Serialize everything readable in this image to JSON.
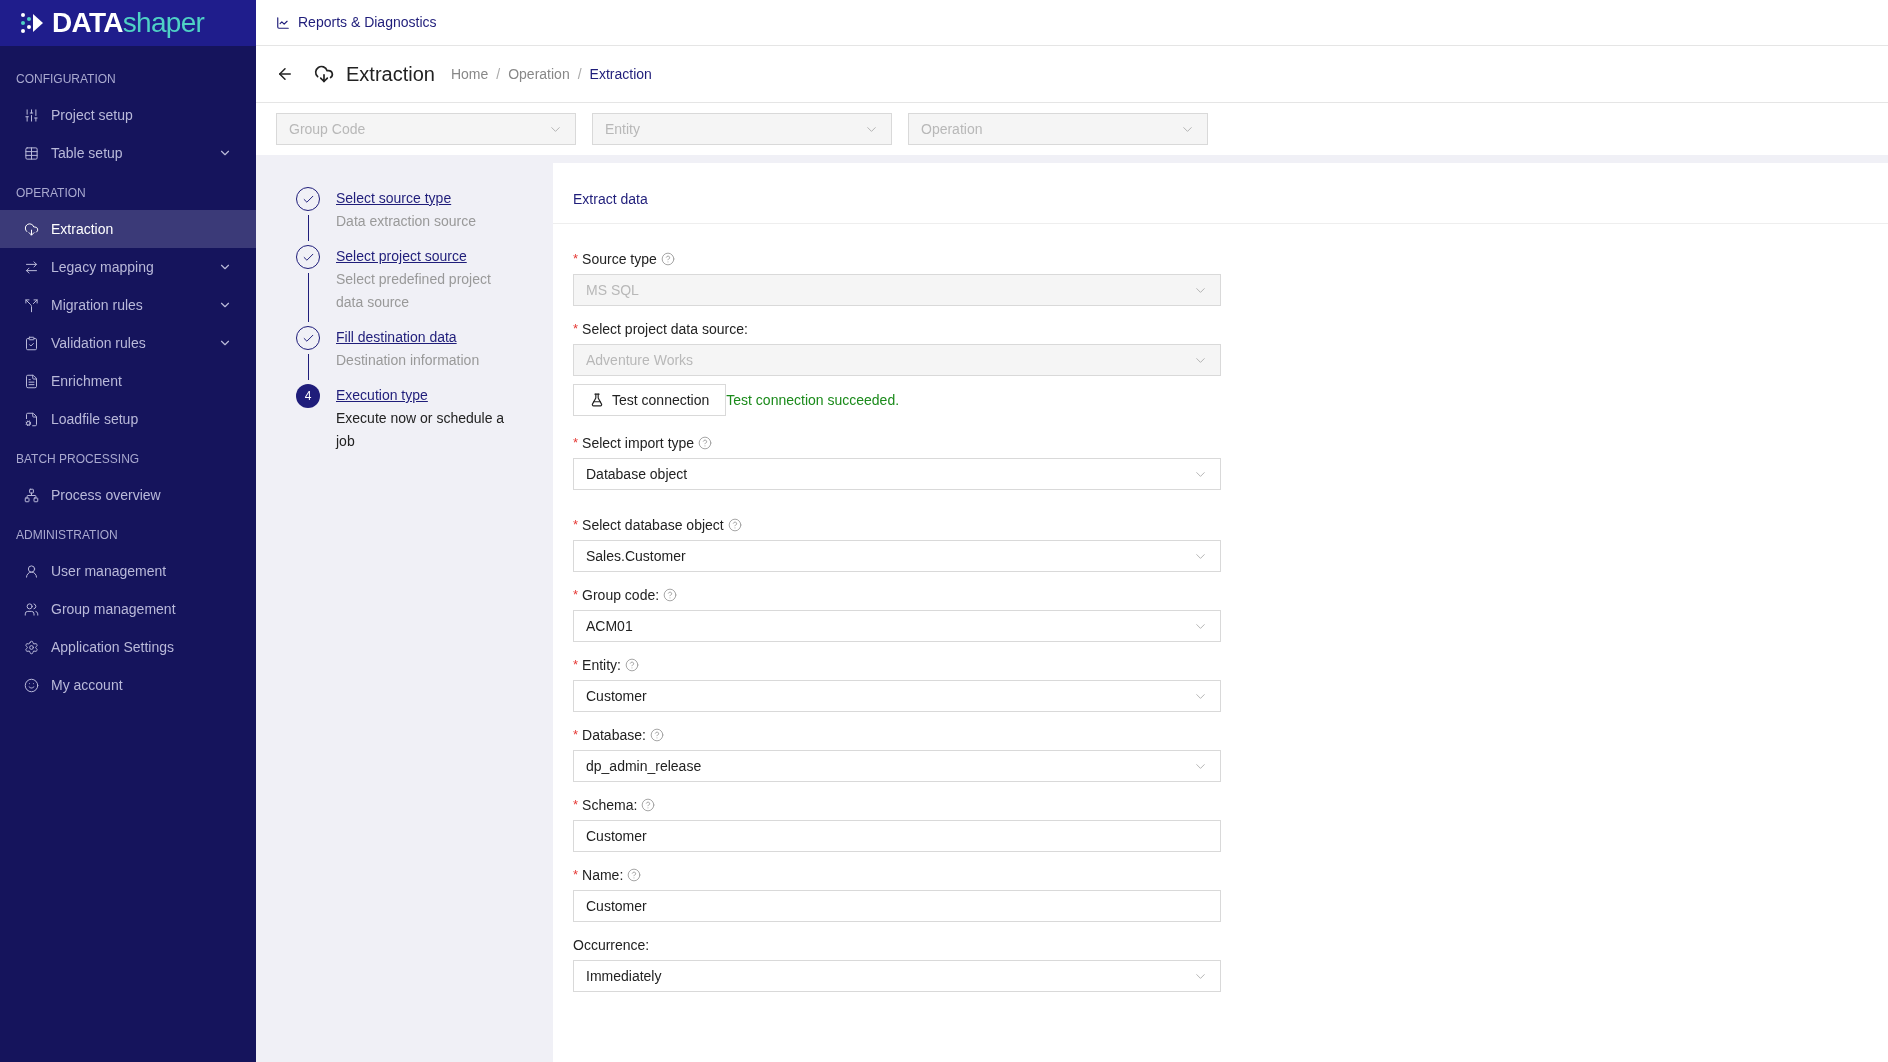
{
  "sidebar": {
    "logo": {
      "bold": "DATA",
      "light": "shaper"
    },
    "sections": [
      {
        "title": "CONFIGURATION",
        "items": [
          {
            "label": "Project setup",
            "expandable": false,
            "selected": false
          },
          {
            "label": "Table setup",
            "expandable": true,
            "selected": false
          }
        ]
      },
      {
        "title": "OPERATION",
        "items": [
          {
            "label": "Extraction",
            "expandable": false,
            "selected": true
          },
          {
            "label": "Legacy mapping",
            "expandable": true,
            "selected": false
          },
          {
            "label": "Migration rules",
            "expandable": true,
            "selected": false
          },
          {
            "label": "Validation rules",
            "expandable": true,
            "selected": false
          },
          {
            "label": "Enrichment",
            "expandable": false,
            "selected": false
          },
          {
            "label": "Loadfile setup",
            "expandable": false,
            "selected": false
          }
        ]
      },
      {
        "title": "BATCH PROCESSING",
        "items": [
          {
            "label": "Process overview",
            "expandable": false,
            "selected": false
          }
        ]
      },
      {
        "title": "ADMINISTRATION",
        "items": [
          {
            "label": "User management",
            "expandable": false,
            "selected": false
          },
          {
            "label": "Group management",
            "expandable": false,
            "selected": false
          },
          {
            "label": "Application Settings",
            "expandable": false,
            "selected": false
          },
          {
            "label": "My account",
            "expandable": false,
            "selected": false
          }
        ]
      }
    ]
  },
  "topbar": {
    "link": "Reports & Diagnostics"
  },
  "page_header": {
    "title": "Extraction",
    "breadcrumb": [
      {
        "label": "Home",
        "selected": false
      },
      {
        "separator": "/",
        "label": "Operation",
        "selected": false
      },
      {
        "separator": "/",
        "label": "Extraction",
        "selected": true
      }
    ]
  },
  "filters": [
    {
      "placeholder": "Group Code"
    },
    {
      "placeholder": "Entity"
    },
    {
      "placeholder": "Operation"
    }
  ],
  "steps": [
    {
      "title": "Select source type",
      "description": "Data extraction source",
      "completed": true
    },
    {
      "title": "Select project source",
      "description": "Select predefined project data source",
      "completed": true
    },
    {
      "title": "Fill destination data",
      "description": "Destination information",
      "completed": true
    },
    {
      "title": "Execution type",
      "description": "Execute now or schedule a job",
      "completed": false,
      "number": "4"
    }
  ],
  "form": {
    "title": "Extract data",
    "fields": [
      {
        "kind": "select",
        "label": "Source type",
        "required_mark": "*",
        "help": true,
        "value": "MS SQL",
        "disabled": true
      },
      {
        "kind": "select",
        "label": "Select project data source:",
        "required_mark": "*",
        "help": false,
        "value": "Adventure Works",
        "disabled": true
      },
      {
        "kind": "test",
        "button": "Test connection",
        "message": "Test connection succeeded."
      },
      {
        "kind": "select",
        "label": "Select import type",
        "required_mark": "*",
        "help": true,
        "value": "Database object",
        "disabled": false
      },
      {
        "kind": "select",
        "label": "Select database object",
        "required_mark": "*",
        "help": true,
        "value": "Sales.Customer",
        "disabled": false
      },
      {
        "kind": "select",
        "label": "Group code:",
        "required_mark": "*",
        "help": true,
        "value": "ACM01",
        "disabled": false
      },
      {
        "kind": "select",
        "label": "Entity:",
        "required_mark": "*",
        "help": true,
        "value": "Customer",
        "disabled": false
      },
      {
        "kind": "select",
        "label": "Database:",
        "required_mark": "*",
        "help": true,
        "value": "dp_admin_release",
        "disabled": false
      },
      {
        "kind": "input",
        "label": "Schema:",
        "required_mark": "*",
        "help": true,
        "value": "Customer",
        "disabled": false
      },
      {
        "kind": "input",
        "label": "Name:",
        "required_mark": "*",
        "help": true,
        "value": "Customer",
        "disabled": false
      },
      {
        "kind": "select",
        "label": "Occurrence:",
        "help": false,
        "value": "Immediately",
        "disabled": false
      }
    ]
  }
}
